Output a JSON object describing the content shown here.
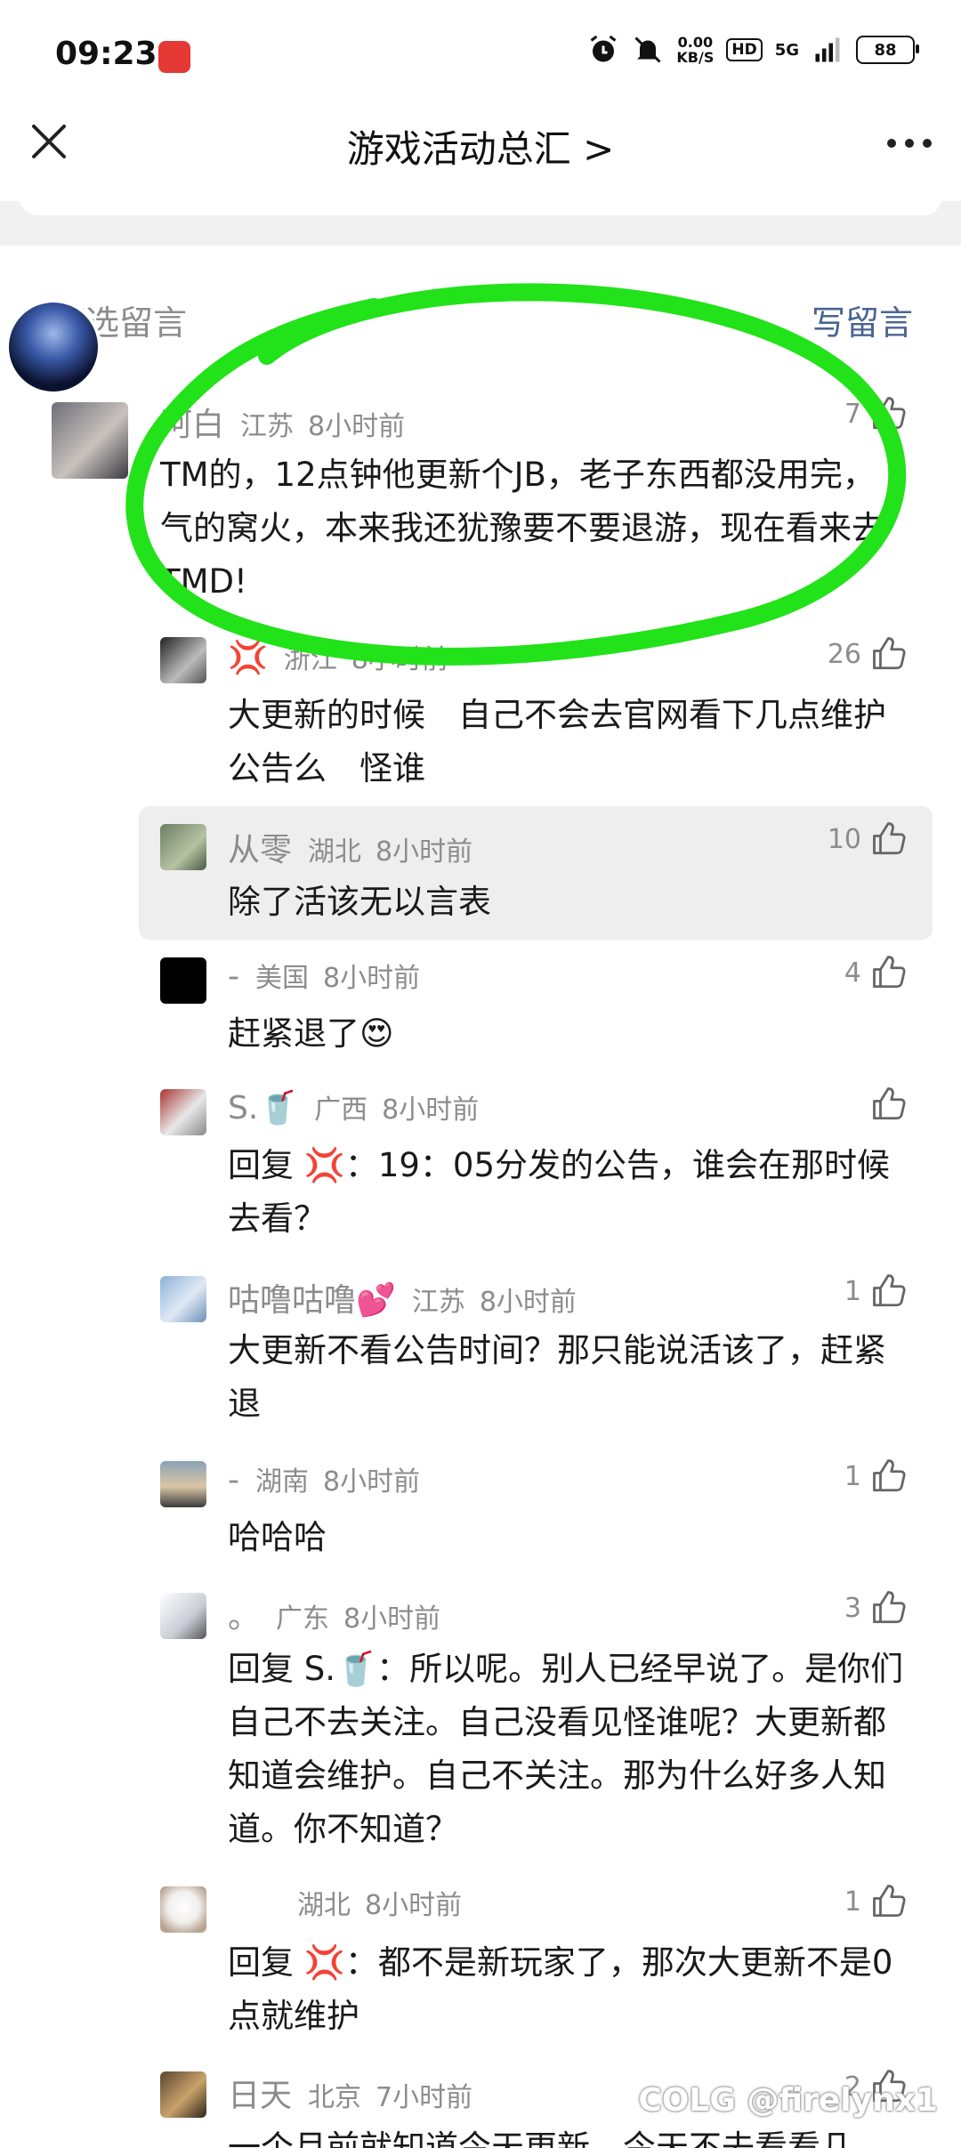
{
  "status_bar": {
    "time": "09:23",
    "speed_top": "0.00",
    "speed_bottom": "KB/S",
    "hd": "HD",
    "network": "5G",
    "battery": "88"
  },
  "header": {
    "title": "游戏活动总汇 >"
  },
  "section": {
    "title": "精选留言",
    "write_label": "写留言"
  },
  "comments": [
    {
      "nick": "阿白",
      "loc": "江苏",
      "time": "8小时前",
      "likes": "7",
      "body": "TM的，12点钟他更新个JB，老子东西都没用完，气的窝火，本来我还犹豫要不要退游，现在看来去TMD!"
    },
    {
      "nick": "💢",
      "loc": "浙江",
      "time": "8小时前",
      "likes": "26",
      "body": "大更新的时候　自己不会去官网看下几点维护公告么　怪谁"
    },
    {
      "nick": "从零",
      "loc": "湖北",
      "time": "8小时前",
      "likes": "10",
      "body": "除了活该无以言表"
    },
    {
      "nick": "-",
      "loc": "美国",
      "time": "8小时前",
      "likes": "4",
      "body": "赶紧退了😍"
    },
    {
      "nick": "S.🥤",
      "loc": "广西",
      "time": "8小时前",
      "likes": "",
      "body": "回复 💢：19：05分发的公告，谁会在那时候去看？"
    },
    {
      "nick": "咕噜咕噜💕",
      "loc": "江苏",
      "time": "8小时前",
      "likes": "1",
      "body": "大更新不看公告时间？那只能说活该了，赶紧退"
    },
    {
      "nick": "-",
      "loc": "湖南",
      "time": "8小时前",
      "likes": "1",
      "body": "哈哈哈"
    },
    {
      "nick": "。",
      "loc": "广东",
      "time": "8小时前",
      "likes": "3",
      "body": "回复 S.🥤：所以呢。别人已经早说了。是你们自己不去关注。自己没看见怪谁呢？大更新都知道会维护。自己不关注。那为什么好多人知道。你不知道？"
    },
    {
      "nick": "",
      "loc": "湖北",
      "time": "8小时前",
      "likes": "1",
      "body": "回复 💢：都不是新玩家了，那次大更新不是0点就维护"
    },
    {
      "nick": "日天",
      "loc": "北京",
      "time": "7小时前",
      "likes": "2",
      "body": "一个月前就知道今天更新，今天不去看看几"
    }
  ],
  "watermark": "COLG @firelynx1",
  "colors": {
    "accent_link": "#4a6590",
    "highlight_stroke": "#22e21a",
    "muted": "#8c8c8c"
  }
}
